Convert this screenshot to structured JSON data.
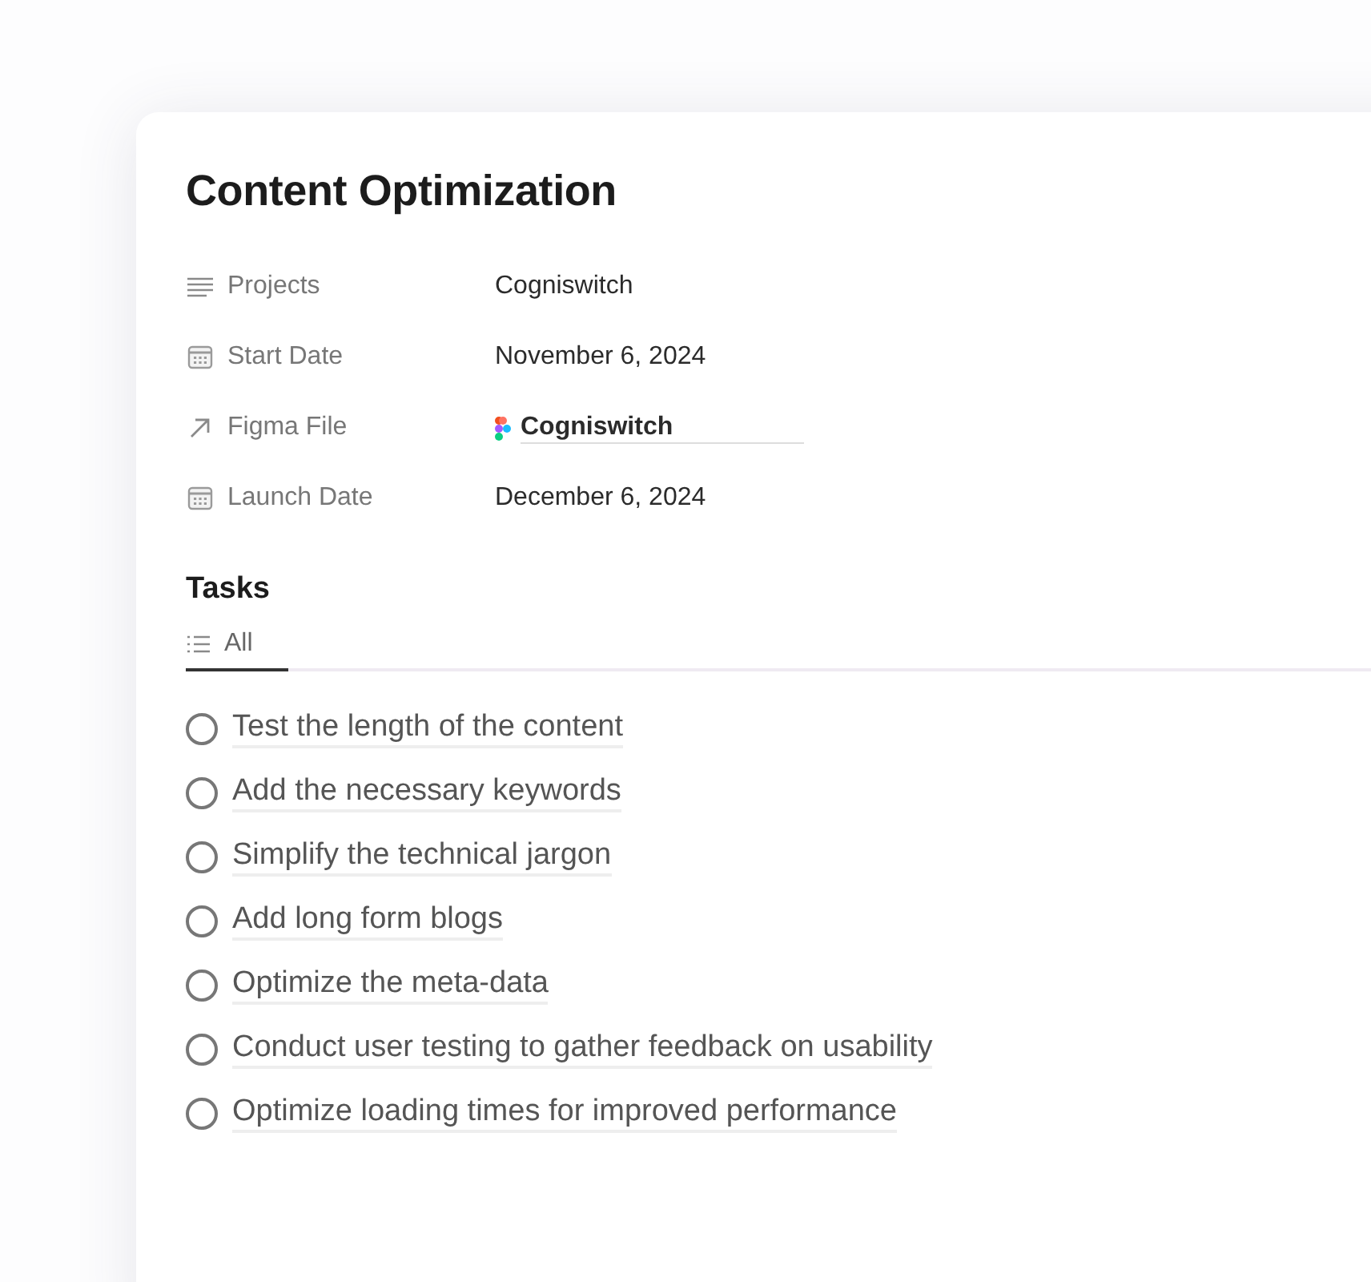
{
  "title": "Content Optimization",
  "properties": [
    {
      "label": "Projects",
      "kind": "text",
      "value": "Cogniswitch"
    },
    {
      "label": "Start Date",
      "kind": "date",
      "value": "November 6, 2024"
    },
    {
      "label": "Figma File",
      "kind": "file",
      "value": "Cogniswitch"
    },
    {
      "label": "Launch Date",
      "kind": "date",
      "value": "December 6, 2024"
    }
  ],
  "tasks_heading": "Tasks",
  "tabs": [
    {
      "label": "All",
      "selected": true
    }
  ],
  "tasks": [
    {
      "label": "Test the length of the content",
      "checked": false
    },
    {
      "label": "Add the necessary keywords",
      "checked": false
    },
    {
      "label": "Simplify the technical jargon",
      "checked": false
    },
    {
      "label": "Add long form blogs",
      "checked": false
    },
    {
      "label": "Optimize the meta-data",
      "checked": false
    },
    {
      "label": "Conduct user testing to gather feedback on usability",
      "checked": false
    },
    {
      "label": "Optimize loading times for improved performance",
      "checked": false
    }
  ]
}
